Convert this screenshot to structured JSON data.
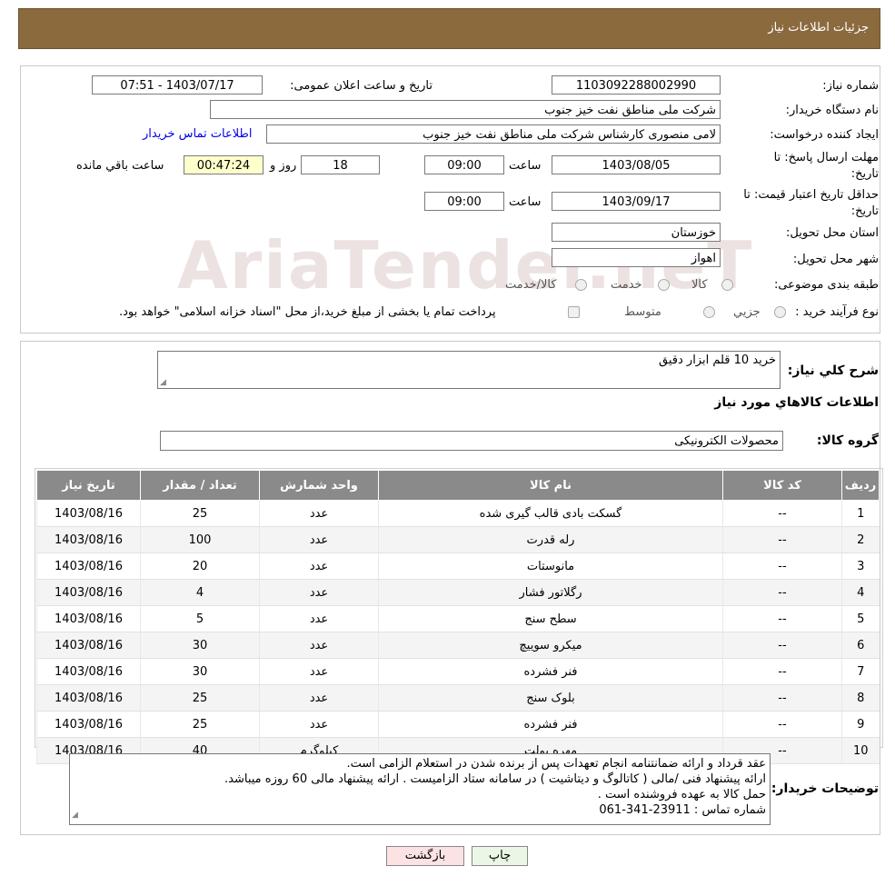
{
  "header": {
    "title": "جزئیات اطلاعات نیاز"
  },
  "watermark": "AriaTender.neT",
  "form": {
    "need_number_label": "شماره نیاز:",
    "need_number": "1103092288002990",
    "announce_label": "تاریخ و ساعت اعلان عمومی:",
    "announce_value": "1403/07/17 - 07:51",
    "buyer_org_label": "نام دستگاه خریدار:",
    "buyer_org": "شرکت ملی مناطق نفت خیز جنوب",
    "creator_label": "ایجاد کننده درخواست:",
    "creator": "لامی منصوری کارشناس شرکت ملی مناطق نفت خیز جنوب",
    "contact_link": "اطلاعات تماس خریدار",
    "deadline_label": "مهلت ارسال پاسخ: تا تاریخ:",
    "deadline_date": "1403/08/05",
    "time_label": "ساعت",
    "deadline_time": "09:00",
    "days": "18",
    "days_label": "روز و",
    "remaining": "00:47:24",
    "remaining_label": "ساعت باقي مانده",
    "validity_label": "حداقل تاریخ اعتبار قیمت: تا تاریخ:",
    "validity_date": "1403/09/17",
    "validity_time": "09:00",
    "province_label": "استان محل تحویل:",
    "province": "خوزستان",
    "city_label": "شهر محل تحویل:",
    "city": "اهواز",
    "category_label": "طبقه بندی موضوعی:",
    "cat_goods": "کالا",
    "cat_service": "خدمت",
    "cat_both": "کالا/خدمت",
    "process_label": "نوع فرآیند خرید :",
    "proc_partial": "جزیي",
    "proc_medium": "متوسط",
    "payment_note": "پرداخت تمام یا بخشی از مبلغ خرید،از محل \"اسناد خزانه اسلامی\" خواهد بود."
  },
  "summary": {
    "label": "شرح كلي نياز:",
    "value": "خرید 10 قلم ابزار دقیق",
    "goods_info_title": "اطلاعات کالاهاي مورد نياز",
    "group_label": "گروه کالا:",
    "group_value": "محصولات الکترونیکی"
  },
  "table": {
    "headers": [
      "رديف",
      "کد کالا",
      "نام کالا",
      "واحد شمارش",
      "تعداد / مقدار",
      "تاریخ نیاز"
    ],
    "rows": [
      [
        "1",
        "--",
        "گسکت بادی قالب گیری شده",
        "عدد",
        "25",
        "1403/08/16"
      ],
      [
        "2",
        "--",
        "رله قدرت",
        "عدد",
        "100",
        "1403/08/16"
      ],
      [
        "3",
        "--",
        "مانوستات",
        "عدد",
        "20",
        "1403/08/16"
      ],
      [
        "4",
        "--",
        "رگلاتور فشار",
        "عدد",
        "4",
        "1403/08/16"
      ],
      [
        "5",
        "--",
        "سطح سنج",
        "عدد",
        "5",
        "1403/08/16"
      ],
      [
        "6",
        "--",
        "میکرو سوییچ",
        "عدد",
        "30",
        "1403/08/16"
      ],
      [
        "7",
        "--",
        "فنر فشرده",
        "عدد",
        "30",
        "1403/08/16"
      ],
      [
        "8",
        "--",
        "بلوک سنج",
        "عدد",
        "25",
        "1403/08/16"
      ],
      [
        "9",
        "--",
        "فنر فشرده",
        "عدد",
        "25",
        "1403/08/16"
      ],
      [
        "10",
        "--",
        "مهره بولت",
        "کیلوگرم",
        "40",
        "1403/08/16"
      ]
    ]
  },
  "notes": {
    "label": "توضیحات خریدار:",
    "line1": "عقد قرداد و ارائه ضمانتنامه انجام تعهدات پس از برنده شدن در استعلام الزامی است.",
    "line2": "ارائه پیشنهاد فنی /مالی ( کاتالوگ و دیتاشیت ) در سامانه ستاد الزامیست . ارائه پیشنهاد مالی 60 روزه میباشد.",
    "line3": "حمل کالا به عهده فروشنده است .",
    "line4": "شماره تماس : 23911-341-061"
  },
  "buttons": {
    "print": "چاپ",
    "back": "بازگشت"
  }
}
